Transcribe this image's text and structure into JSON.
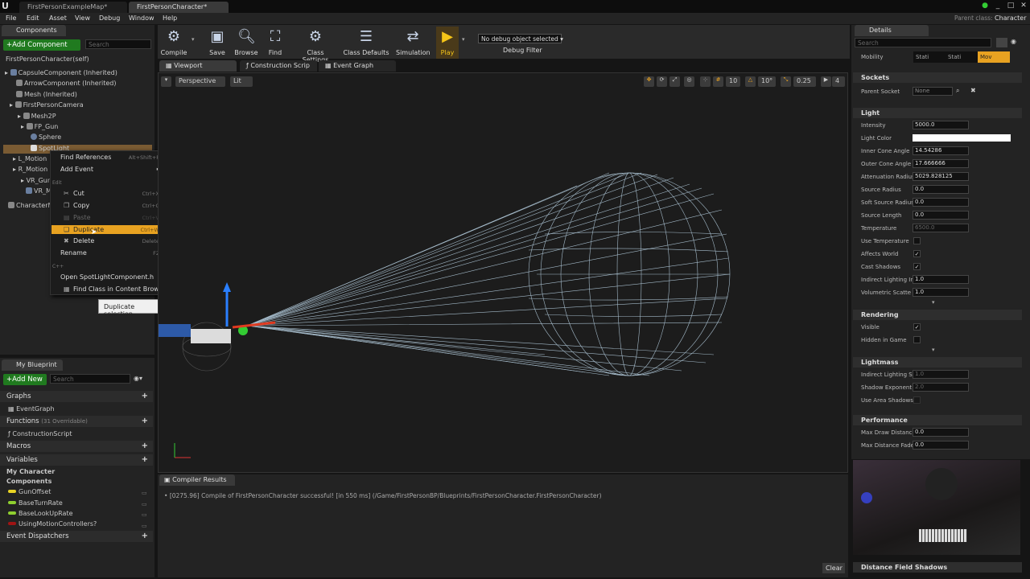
{
  "tabs": [
    "FirstPersonExampleMap*",
    "FirstPersonCharacter*"
  ],
  "menu": [
    "File",
    "Edit",
    "Asset",
    "View",
    "Debug",
    "Window",
    "Help"
  ],
  "parent_class": {
    "label": "Parent class:",
    "value": "Character"
  },
  "components": {
    "title": "Components",
    "add_button": "+Add Component",
    "search_placeholder": "Search",
    "self": "FirstPersonCharacter(self)",
    "items": [
      "CapsuleComponent (Inherited)",
      "ArrowComponent (Inherited)",
      "Mesh (Inherited)",
      "FirstPersonCamera",
      "Mesh2P",
      "FP_Gun",
      "Sphere",
      "SpotLight",
      "L_Motion",
      "R_Motion",
      "VR_Gun",
      "VR_M",
      "CharacterM"
    ]
  },
  "context_menu": {
    "find_references": "Find References",
    "find_references_shortcut": "Alt+Shift+F",
    "add_event": "Add Event",
    "edit_section": "Edit",
    "cut": "Cut",
    "cut_shortcut": "Ctrl+X",
    "copy": "Copy",
    "copy_shortcut": "Ctrl+C",
    "paste": "Paste",
    "paste_shortcut": "Ctrl+V",
    "duplicate": "Duplicate",
    "duplicate_shortcut": "Ctrl+W",
    "delete": "Delete",
    "delete_shortcut": "Delete",
    "rename": "Rename",
    "rename_shortcut": "F2",
    "cpp_section": "C++",
    "open_header": "Open SpotLightComponent.h",
    "find_class": "Find Class in Content Browser",
    "tooltip": "Duplicate selection"
  },
  "toolbar": {
    "compile": "Compile",
    "save": "Save",
    "browse": "Browse",
    "find": "Find",
    "class_settings": "Class Settings",
    "class_defaults": "Class Defaults",
    "simulation": "Simulation",
    "play": "Play",
    "debug_select": "No debug object selected",
    "debug_filter": "Debug Filter"
  },
  "editor_tabs": [
    "Viewport",
    "Construction Scrip",
    "Event Graph"
  ],
  "viewport": {
    "perspective": "Perspective",
    "lit": "Lit",
    "grid_size": "10",
    "rot_snap": "10°",
    "scale_snap": "0.25",
    "cam_speed": "4"
  },
  "compiler": {
    "title": "Compiler Results",
    "message": "[0275.96] Compile of FirstPersonCharacter successful! [in 550 ms] (/Game/FirstPersonBP/Blueprints/FirstPersonCharacter.FirstPersonCharacter)",
    "clear": "Clear"
  },
  "my_blueprint": {
    "title": "My Blueprint",
    "add_new": "+Add New",
    "search_placeholder": "Search",
    "graphs": "Graphs",
    "event_graph": "EventGraph",
    "functions": "Functions",
    "functions_count": "(31 Overridable)",
    "construction_script": "ConstructionScript",
    "macros": "Macros",
    "variables": "Variables",
    "my_character": "My Character",
    "components": "Components",
    "vars": [
      "GunOffset",
      "BaseTurnRate",
      "BaseLookUpRate",
      "UsingMotionControllers?"
    ],
    "var_colors": [
      "#e8d324",
      "#8fcf2f",
      "#8fcf2f",
      "#a01414"
    ],
    "event_dispatchers": "Event Dispatchers"
  },
  "details": {
    "title": "Details",
    "search_placeholder": "Search",
    "mobility_label": "Mobility",
    "mobility_options": [
      "Stati",
      "Stati",
      "Mov"
    ],
    "sockets": "Sockets",
    "parent_socket_label": "Parent Socket",
    "parent_socket": "None",
    "light": "Light",
    "props": [
      {
        "label": "Intensity",
        "value": "5000.0"
      },
      {
        "label": "Light Color",
        "value": ""
      },
      {
        "label": "Inner Cone Angle",
        "value": "14.54286"
      },
      {
        "label": "Outer Cone Angle",
        "value": "17.666666"
      },
      {
        "label": "Attenuation Radius",
        "value": "5029.828125"
      },
      {
        "label": "Source Radius",
        "value": "0.0"
      },
      {
        "label": "Soft Source Radius",
        "value": "0.0"
      },
      {
        "label": "Source Length",
        "value": "0.0"
      },
      {
        "label": "Temperature",
        "value": "6500.0"
      },
      {
        "label": "Use Temperature",
        "value": ""
      },
      {
        "label": "Affects World",
        "value": "✓"
      },
      {
        "label": "Cast Shadows",
        "value": "✓"
      },
      {
        "label": "Indirect Lighting In",
        "value": "1.0"
      },
      {
        "label": "Volumetric Scatte",
        "value": "1.0"
      }
    ],
    "rendering": "Rendering",
    "visible": "Visible",
    "hidden_in_game": "Hidden in Game",
    "lightmass": "Lightmass",
    "lm_props": [
      {
        "label": "Indirect Lighting S",
        "value": "1.0"
      },
      {
        "label": "Shadow Exponent",
        "value": "2.0"
      },
      {
        "label": "Use Area Shadows",
        "value": ""
      }
    ],
    "performance": "Performance",
    "perf_props": [
      {
        "label": "Max Draw Distance",
        "value": "0.0"
      },
      {
        "label": "Max Distance Fade",
        "value": "0.0"
      }
    ],
    "distance_field": "Distance Field Shadows"
  }
}
